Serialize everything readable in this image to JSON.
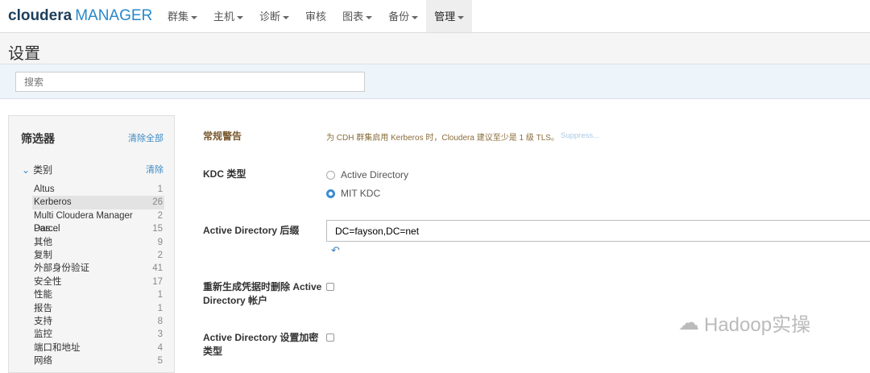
{
  "nav": {
    "logo_main": "cloudera",
    "logo_sub": "MANAGER",
    "items": [
      {
        "label": "群集",
        "caret": true
      },
      {
        "label": "主机",
        "caret": true
      },
      {
        "label": "诊断",
        "caret": true
      },
      {
        "label": "审核",
        "caret": false
      },
      {
        "label": "图表",
        "caret": true
      },
      {
        "label": "备份",
        "caret": true
      },
      {
        "label": "管理",
        "caret": true,
        "active": true
      }
    ]
  },
  "page": {
    "title": "设置"
  },
  "search": {
    "placeholder": "搜索"
  },
  "filter": {
    "title": "筛选器",
    "clear_all": "清除全部",
    "category_label": "类别",
    "category_clear": "清除",
    "items": [
      {
        "label": "Altus",
        "count": "1"
      },
      {
        "label": "Kerberos",
        "count": "26",
        "selected": true
      },
      {
        "label": "Multi Cloudera Manager Das...",
        "count": "2"
      },
      {
        "label": "Parcel",
        "count": "15"
      },
      {
        "label": "其他",
        "count": "9"
      },
      {
        "label": "复制",
        "count": "2"
      },
      {
        "label": "外部身份验证",
        "count": "41"
      },
      {
        "label": "安全性",
        "count": "17"
      },
      {
        "label": "性能",
        "count": "1"
      },
      {
        "label": "报告",
        "count": "1"
      },
      {
        "label": "支持",
        "count": "8"
      },
      {
        "label": "监控",
        "count": "3"
      },
      {
        "label": "端口和地址",
        "count": "4"
      },
      {
        "label": "网络",
        "count": "5"
      }
    ]
  },
  "settings": {
    "general_warning_label": "常规警告",
    "general_warning_text": "为 CDH 群集启用 Kerberos 时，Cloudera 建议至少是 1 级 TLS。",
    "suppress": "Suppress...",
    "kdc_label": "KDC 类型",
    "kdc_opt1": "Active Directory",
    "kdc_opt2": "MIT KDC",
    "ad_suffix_label": "Active Directory 后缀",
    "ad_suffix_value": "DC=fayson,DC=net",
    "delete_label": "重新生成凭据时删除 Active Directory 帐户",
    "encrypt_label": "Active Directory 设置加密类型"
  },
  "watermark": "Hadoop实操"
}
